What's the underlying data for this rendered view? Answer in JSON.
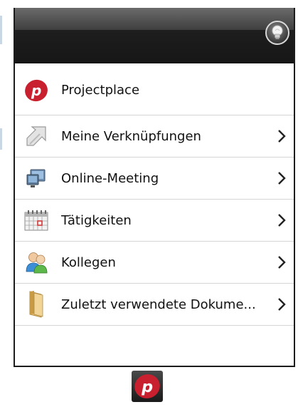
{
  "header": {
    "tip_icon": "lightbulb-icon"
  },
  "menu": {
    "items": [
      {
        "label": "Projectplace",
        "icon": "projectplace-logo-icon",
        "has_submenu": false
      },
      {
        "label": "Meine Verknüpfungen",
        "icon": "shortcut-arrow-icon",
        "has_submenu": true
      },
      {
        "label": "Online-Meeting",
        "icon": "online-meeting-icon",
        "has_submenu": true
      },
      {
        "label": "Tätigkeiten",
        "icon": "calendar-icon",
        "has_submenu": true
      },
      {
        "label": "Kollegen",
        "icon": "people-icon",
        "has_submenu": true
      },
      {
        "label": "Zuletzt verwendete Dokume...",
        "icon": "folder-icon",
        "has_submenu": true
      }
    ]
  },
  "taskbar": {
    "icon": "projectplace-logo-icon"
  },
  "colors": {
    "brand_red": "#c8202f",
    "header_dark": "#161616",
    "divider": "#d5d5d5"
  }
}
